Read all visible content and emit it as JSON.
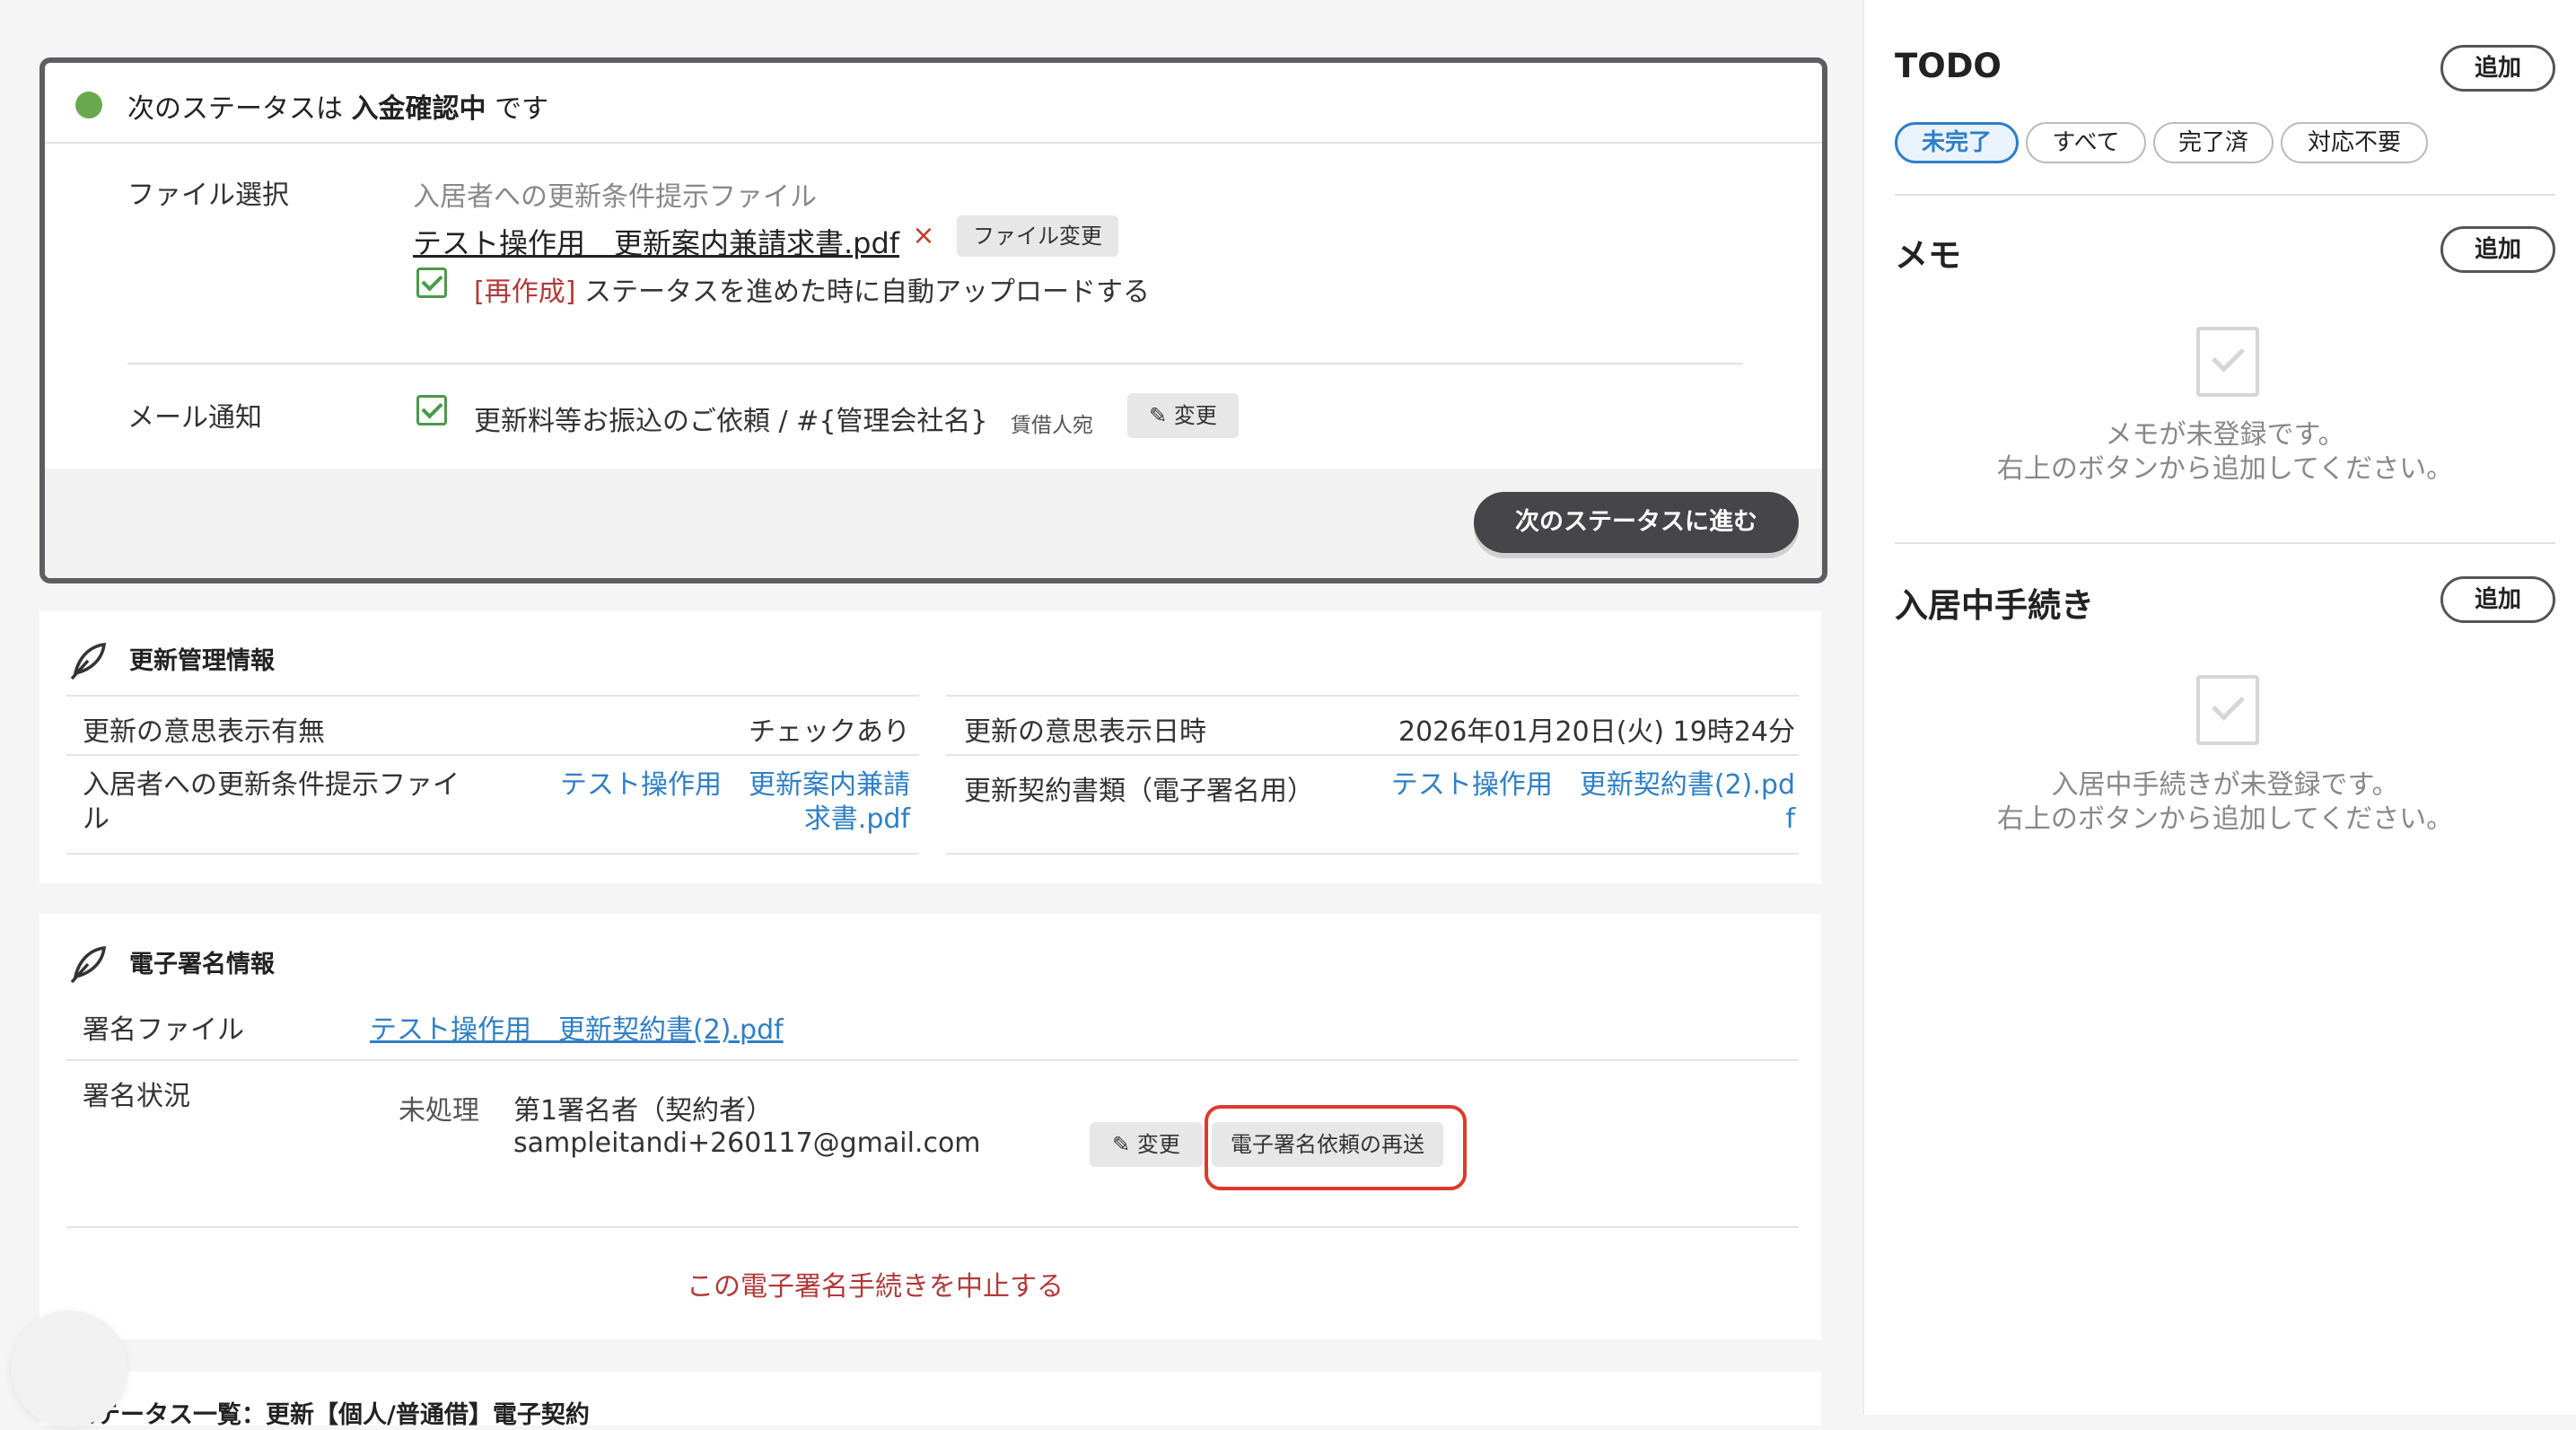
{
  "status": {
    "prefix": "次のステータスは",
    "name": "入金確認中",
    "suffix": "です",
    "file_label": "ファイル選択",
    "file_caption": "入居者への更新条件提示ファイル",
    "file_name": "テスト操作用　更新案内兼請求書.pdf",
    "remove_icon": "×",
    "change_file_label": "ファイル変更",
    "recreate_tag": "[再作成]",
    "auto_upload_text": "ステータスを進めた時に自動アップロードする",
    "mail_label": "メール通知",
    "mail_subject": "更新料等お振込のご依頼 / #{管理会社名}",
    "mail_recipient": "賃借人宛",
    "change_label": "変更",
    "next_button": "次のステータスに進む"
  },
  "renewal_info": {
    "title": "更新管理情報",
    "rows": [
      {
        "label": "更新の意思表示有無",
        "value": "チェックあり"
      },
      {
        "label": "更新の意思表示日時",
        "value": "2026年01月20日(火) 19時24分"
      },
      {
        "label_line1": "入居者への更新条件提示ファイ",
        "label_line2": "ル",
        "value_line1": "テスト操作用　更新案内兼請",
        "value_line2": "求書.pdf"
      },
      {
        "label": "更新契約書類（電子署名用）",
        "value_line1": "テスト操作用　更新契約書(2).pd",
        "value_line2": "f"
      }
    ]
  },
  "esign_info": {
    "title": "電子署名情報",
    "file_label": "署名ファイル",
    "file_value": "テスト操作用　更新契約書(2).pdf",
    "state_label": "署名状況",
    "state_value": "未処理",
    "signer_role": "第1署名者（契約者）",
    "signer_email": "sampleitandi+260117@gmail.com",
    "change_label": "変更",
    "resend_label": "電子署名依頼の再送",
    "cancel_link": "この電子署名手続きを中止する"
  },
  "bottom": {
    "title": "ステータス一覧：更新【個人/普通借】電子契約"
  },
  "sidebar": {
    "todo_title": "TODO",
    "add_label": "追加",
    "tabs": [
      "未完了",
      "すべて",
      "完了済",
      "対応不要"
    ],
    "memo_title": "メモ",
    "memo_empty_line1": "メモが未登録です。",
    "memo_empty_line2": "右上のボタンから追加してください。",
    "procedure_title": "入居中手続き",
    "procedure_empty_line1": "入居中手続きが未登録です。",
    "procedure_empty_line2": "右上のボタンから追加してください。"
  },
  "colors": {
    "status_dot": "#6aa84f",
    "link": "#2f7fc5",
    "danger": "#b23a3a",
    "highlight": "#e0392b"
  }
}
